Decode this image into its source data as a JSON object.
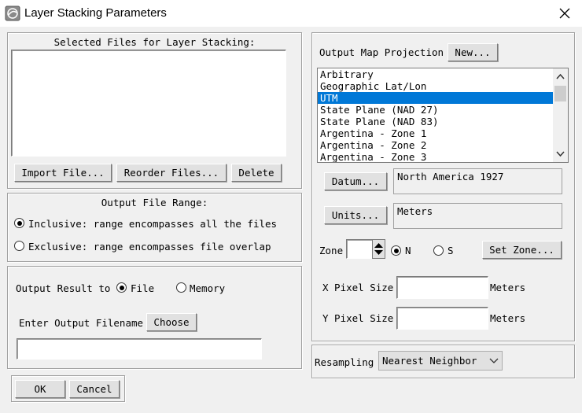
{
  "window": {
    "title": "Layer Stacking Parameters"
  },
  "selected_files": {
    "label": "Selected Files for Layer Stacking:"
  },
  "buttons": {
    "import_file": "Import File...",
    "reorder_files": "Reorder Files...",
    "delete": "Delete",
    "choose": "Choose",
    "ok": "OK",
    "cancel": "Cancel",
    "new": "New...",
    "datum": "Datum...",
    "units": "Units...",
    "set_zone": "Set Zone..."
  },
  "range": {
    "label": "Output File Range:",
    "inclusive": "Inclusive: range encompasses all the files",
    "exclusive": "Exclusive: range encompasses file overlap",
    "selected": "inclusive"
  },
  "output": {
    "label": "Output Result to",
    "file": "File",
    "memory": "Memory",
    "selected": "file",
    "filename_label": "Enter Output Filename",
    "filename_value": ""
  },
  "projection": {
    "label": "Output Map Projection",
    "items": [
      "Arbitrary",
      "Geographic Lat/Lon",
      "UTM",
      "State Plane (NAD 27)",
      "State Plane (NAD 83)",
      "Argentina - Zone 1",
      "Argentina - Zone 2",
      "Argentina - Zone 3"
    ],
    "selected_index": 2
  },
  "datum": {
    "value": "North America 1927"
  },
  "units": {
    "value": "Meters"
  },
  "zone": {
    "label": "Zone",
    "value": "",
    "n_label": "N",
    "s_label": "S",
    "selected": "N"
  },
  "pixel": {
    "x_label": "X Pixel Size",
    "y_label": "Y Pixel Size",
    "x_value": "",
    "y_value": "",
    "x_unit": "Meters",
    "y_unit": "Meters"
  },
  "resampling": {
    "label": "Resampling",
    "value": "Nearest Neighbor"
  },
  "colors": {
    "selection": "#0078d7",
    "dialog_bg": "#f0f0f0"
  }
}
